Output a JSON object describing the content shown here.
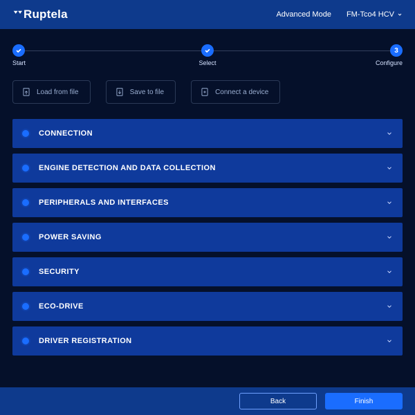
{
  "header": {
    "logo_text": "Ruptela",
    "advanced_mode": "Advanced Mode",
    "device_model": "FM-Tco4 HCV"
  },
  "stepper": {
    "start": {
      "label": "Start"
    },
    "select": {
      "label": "Select"
    },
    "configure": {
      "label": "Configure",
      "num": "3"
    }
  },
  "actions": {
    "load": "Load from file",
    "save": "Save to file",
    "connect": "Connect a device"
  },
  "sections": [
    {
      "title": "CONNECTION"
    },
    {
      "title": "ENGINE DETECTION AND DATA COLLECTION"
    },
    {
      "title": "PERIPHERALS AND INTERFACES"
    },
    {
      "title": "POWER SAVING"
    },
    {
      "title": "SECURITY"
    },
    {
      "title": "ECO-DRIVE"
    },
    {
      "title": "DRIVER REGISTRATION"
    }
  ],
  "footer": {
    "back": "Back",
    "finish": "Finish"
  }
}
